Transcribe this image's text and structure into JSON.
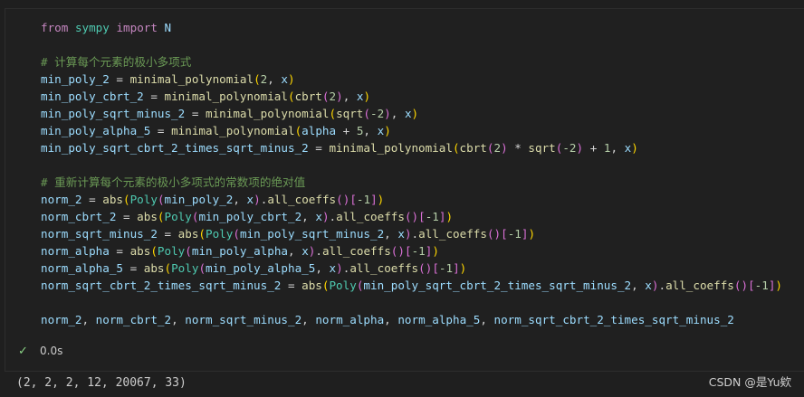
{
  "cell": {
    "lines": [
      [
        {
          "t": "from",
          "c": "kw"
        },
        {
          "t": " "
        },
        {
          "t": "sympy",
          "c": "mod"
        },
        {
          "t": " "
        },
        {
          "t": "import",
          "c": "kw"
        },
        {
          "t": " "
        },
        {
          "t": "N",
          "c": "var"
        }
      ],
      [],
      [
        {
          "t": "# 计算每个元素的极小多项式",
          "c": "cmt"
        }
      ],
      [
        {
          "t": "min_poly_2",
          "c": "var"
        },
        {
          "t": " = "
        },
        {
          "t": "minimal_polynomial",
          "c": "fn"
        },
        {
          "t": "(",
          "c": "p1"
        },
        {
          "t": "2",
          "c": "num"
        },
        {
          "t": ", "
        },
        {
          "t": "x",
          "c": "var"
        },
        {
          "t": ")",
          "c": "p1"
        }
      ],
      [
        {
          "t": "min_poly_cbrt_2",
          "c": "var"
        },
        {
          "t": " = "
        },
        {
          "t": "minimal_polynomial",
          "c": "fn"
        },
        {
          "t": "(",
          "c": "p1"
        },
        {
          "t": "cbrt",
          "c": "fn"
        },
        {
          "t": "(",
          "c": "p2"
        },
        {
          "t": "2",
          "c": "num"
        },
        {
          "t": ")",
          "c": "p2"
        },
        {
          "t": ", "
        },
        {
          "t": "x",
          "c": "var"
        },
        {
          "t": ")",
          "c": "p1"
        }
      ],
      [
        {
          "t": "min_poly_sqrt_minus_2",
          "c": "var"
        },
        {
          "t": " = "
        },
        {
          "t": "minimal_polynomial",
          "c": "fn"
        },
        {
          "t": "(",
          "c": "p1"
        },
        {
          "t": "sqrt",
          "c": "fn"
        },
        {
          "t": "(",
          "c": "p2"
        },
        {
          "t": "-2",
          "c": "num"
        },
        {
          "t": ")",
          "c": "p2"
        },
        {
          "t": ", "
        },
        {
          "t": "x",
          "c": "var"
        },
        {
          "t": ")",
          "c": "p1"
        }
      ],
      [
        {
          "t": "min_poly_alpha_5",
          "c": "var"
        },
        {
          "t": " = "
        },
        {
          "t": "minimal_polynomial",
          "c": "fn"
        },
        {
          "t": "(",
          "c": "p1"
        },
        {
          "t": "alpha",
          "c": "var"
        },
        {
          "t": " + "
        },
        {
          "t": "5",
          "c": "num"
        },
        {
          "t": ", "
        },
        {
          "t": "x",
          "c": "var"
        },
        {
          "t": ")",
          "c": "p1"
        }
      ],
      [
        {
          "t": "min_poly_sqrt_cbrt_2_times_sqrt_minus_2",
          "c": "var"
        },
        {
          "t": " = "
        },
        {
          "t": "minimal_polynomial",
          "c": "fn"
        },
        {
          "t": "(",
          "c": "p1"
        },
        {
          "t": "cbrt",
          "c": "fn"
        },
        {
          "t": "(",
          "c": "p2"
        },
        {
          "t": "2",
          "c": "num"
        },
        {
          "t": ")",
          "c": "p2"
        },
        {
          "t": " * "
        },
        {
          "t": "sqrt",
          "c": "fn"
        },
        {
          "t": "(",
          "c": "p2"
        },
        {
          "t": "-2",
          "c": "num"
        },
        {
          "t": ")",
          "c": "p2"
        },
        {
          "t": " + "
        },
        {
          "t": "1",
          "c": "num"
        },
        {
          "t": ", "
        },
        {
          "t": "x",
          "c": "var"
        },
        {
          "t": ")",
          "c": "p1"
        }
      ],
      [],
      [
        {
          "t": "# 重新计算每个元素的极小多项式的常数项的绝对值",
          "c": "cmt"
        }
      ],
      [
        {
          "t": "norm_2",
          "c": "var"
        },
        {
          "t": " = "
        },
        {
          "t": "abs",
          "c": "fn"
        },
        {
          "t": "(",
          "c": "p1"
        },
        {
          "t": "Poly",
          "c": "cls"
        },
        {
          "t": "(",
          "c": "p2"
        },
        {
          "t": "min_poly_2",
          "c": "var"
        },
        {
          "t": ", "
        },
        {
          "t": "x",
          "c": "var"
        },
        {
          "t": ")",
          "c": "p2"
        },
        {
          "t": "."
        },
        {
          "t": "all_coeffs",
          "c": "fn"
        },
        {
          "t": "()",
          "c": "p2"
        },
        {
          "t": "[",
          "c": "p2"
        },
        {
          "t": "-1",
          "c": "num"
        },
        {
          "t": "]",
          "c": "p2"
        },
        {
          "t": ")",
          "c": "p1"
        }
      ],
      [
        {
          "t": "norm_cbrt_2",
          "c": "var"
        },
        {
          "t": " = "
        },
        {
          "t": "abs",
          "c": "fn"
        },
        {
          "t": "(",
          "c": "p1"
        },
        {
          "t": "Poly",
          "c": "cls"
        },
        {
          "t": "(",
          "c": "p2"
        },
        {
          "t": "min_poly_cbrt_2",
          "c": "var"
        },
        {
          "t": ", "
        },
        {
          "t": "x",
          "c": "var"
        },
        {
          "t": ")",
          "c": "p2"
        },
        {
          "t": "."
        },
        {
          "t": "all_coeffs",
          "c": "fn"
        },
        {
          "t": "()",
          "c": "p2"
        },
        {
          "t": "[",
          "c": "p2"
        },
        {
          "t": "-1",
          "c": "num"
        },
        {
          "t": "]",
          "c": "p2"
        },
        {
          "t": ")",
          "c": "p1"
        }
      ],
      [
        {
          "t": "norm_sqrt_minus_2",
          "c": "var"
        },
        {
          "t": " = "
        },
        {
          "t": "abs",
          "c": "fn"
        },
        {
          "t": "(",
          "c": "p1"
        },
        {
          "t": "Poly",
          "c": "cls"
        },
        {
          "t": "(",
          "c": "p2"
        },
        {
          "t": "min_poly_sqrt_minus_2",
          "c": "var"
        },
        {
          "t": ", "
        },
        {
          "t": "x",
          "c": "var"
        },
        {
          "t": ")",
          "c": "p2"
        },
        {
          "t": "."
        },
        {
          "t": "all_coeffs",
          "c": "fn"
        },
        {
          "t": "()",
          "c": "p2"
        },
        {
          "t": "[",
          "c": "p2"
        },
        {
          "t": "-1",
          "c": "num"
        },
        {
          "t": "]",
          "c": "p2"
        },
        {
          "t": ")",
          "c": "p1"
        }
      ],
      [
        {
          "t": "norm_alpha",
          "c": "var"
        },
        {
          "t": " = "
        },
        {
          "t": "abs",
          "c": "fn"
        },
        {
          "t": "(",
          "c": "p1"
        },
        {
          "t": "Poly",
          "c": "cls"
        },
        {
          "t": "(",
          "c": "p2"
        },
        {
          "t": "min_poly_alpha",
          "c": "var"
        },
        {
          "t": ", "
        },
        {
          "t": "x",
          "c": "var"
        },
        {
          "t": ")",
          "c": "p2"
        },
        {
          "t": "."
        },
        {
          "t": "all_coeffs",
          "c": "fn"
        },
        {
          "t": "()",
          "c": "p2"
        },
        {
          "t": "[",
          "c": "p2"
        },
        {
          "t": "-1",
          "c": "num"
        },
        {
          "t": "]",
          "c": "p2"
        },
        {
          "t": ")",
          "c": "p1"
        }
      ],
      [
        {
          "t": "norm_alpha_5",
          "c": "var"
        },
        {
          "t": " = "
        },
        {
          "t": "abs",
          "c": "fn"
        },
        {
          "t": "(",
          "c": "p1"
        },
        {
          "t": "Poly",
          "c": "cls"
        },
        {
          "t": "(",
          "c": "p2"
        },
        {
          "t": "min_poly_alpha_5",
          "c": "var"
        },
        {
          "t": ", "
        },
        {
          "t": "x",
          "c": "var"
        },
        {
          "t": ")",
          "c": "p2"
        },
        {
          "t": "."
        },
        {
          "t": "all_coeffs",
          "c": "fn"
        },
        {
          "t": "()",
          "c": "p2"
        },
        {
          "t": "[",
          "c": "p2"
        },
        {
          "t": "-1",
          "c": "num"
        },
        {
          "t": "]",
          "c": "p2"
        },
        {
          "t": ")",
          "c": "p1"
        }
      ],
      [
        {
          "t": "norm_sqrt_cbrt_2_times_sqrt_minus_2",
          "c": "var"
        },
        {
          "t": " = "
        },
        {
          "t": "abs",
          "c": "fn"
        },
        {
          "t": "(",
          "c": "p1"
        },
        {
          "t": "Poly",
          "c": "cls"
        },
        {
          "t": "(",
          "c": "p2"
        },
        {
          "t": "min_poly_sqrt_cbrt_2_times_sqrt_minus_2",
          "c": "var"
        },
        {
          "t": ", "
        },
        {
          "t": "x",
          "c": "var"
        },
        {
          "t": ")",
          "c": "p2"
        },
        {
          "t": "."
        },
        {
          "t": "all_coeffs",
          "c": "fn"
        },
        {
          "t": "()",
          "c": "p2"
        },
        {
          "t": "[",
          "c": "p2"
        },
        {
          "t": "-1",
          "c": "num"
        },
        {
          "t": "]",
          "c": "p2"
        },
        {
          "t": ")",
          "c": "p1"
        }
      ],
      [],
      [
        {
          "t": "norm_2",
          "c": "var"
        },
        {
          "t": ", "
        },
        {
          "t": "norm_cbrt_2",
          "c": "var"
        },
        {
          "t": ", "
        },
        {
          "t": "norm_sqrt_minus_2",
          "c": "var"
        },
        {
          "t": ", "
        },
        {
          "t": "norm_alpha",
          "c": "var"
        },
        {
          "t": ", "
        },
        {
          "t": "norm_alpha_5",
          "c": "var"
        },
        {
          "t": ", "
        },
        {
          "t": "norm_sqrt_cbrt_2_times_sqrt_minus_2",
          "c": "var"
        }
      ]
    ]
  },
  "status": {
    "icon": "check-icon",
    "time": "0.0s"
  },
  "output": "(2, 2, 2, 12, 20067, 33)",
  "watermark": "CSDN @是Yu欸"
}
